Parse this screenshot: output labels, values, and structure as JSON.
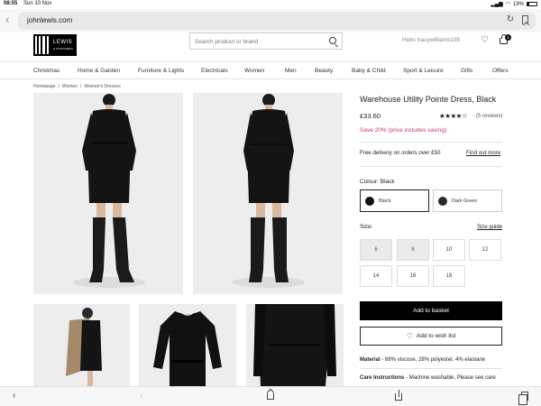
{
  "status": {
    "time": "08:55",
    "date": "Sun 10 Nov",
    "battery": "19%"
  },
  "browser": {
    "url": "johnlewis.com"
  },
  "header": {
    "logo_line1": "LEWIS",
    "logo_line2": "& PARTNERS",
    "search_placeholder": "Search product or brand",
    "greeting": "Hello tracywilliams135",
    "basket_count": "1"
  },
  "nav": [
    "Christmas",
    "Home & Garden",
    "Furniture & Lights",
    "Electricals",
    "Women",
    "Men",
    "Beauty",
    "Baby & Child",
    "Sport & Leisure",
    "Gifts",
    "Offers"
  ],
  "breadcrumb": [
    "Homepage",
    "Women",
    "Women's Dresses"
  ],
  "product": {
    "title": "Warehouse Utility Pointe Dress, Black",
    "price": "£33.60",
    "stars": "★★★★☆",
    "rating": 4,
    "reviews": "(5 reviews)",
    "saving": "Save 20% (price includes saving)",
    "delivery": "Free delivery on orders over £50",
    "find_out_more": "Find out more",
    "colour_label": "Colour:",
    "colour_value": "Black",
    "colours": [
      {
        "name": "Black",
        "hex": "#111111",
        "selected": true
      },
      {
        "name": "Dark Green",
        "hex": "#2a2a2a",
        "selected": false
      }
    ],
    "size_label": "Size:",
    "size_guide": "Size guide",
    "sizes": [
      {
        "label": "6",
        "available": false
      },
      {
        "label": "8",
        "available": false
      },
      {
        "label": "10",
        "available": true
      },
      {
        "label": "12",
        "available": true
      },
      {
        "label": "14",
        "available": true
      },
      {
        "label": "16",
        "available": true
      },
      {
        "label": "18",
        "available": true
      }
    ],
    "add_to_basket": "Add to basket",
    "wishlist": "Add to wish list",
    "material_label": "Material",
    "material_text": " - 68% viscose, 28% polyester, 4% elastane",
    "care_label": "Care Instructions",
    "care_text": " - Machine washable, Please see care"
  },
  "colors": {
    "accent_saving": "#c8385a",
    "primary_button": "#000000",
    "image_bg": "#ededed"
  }
}
